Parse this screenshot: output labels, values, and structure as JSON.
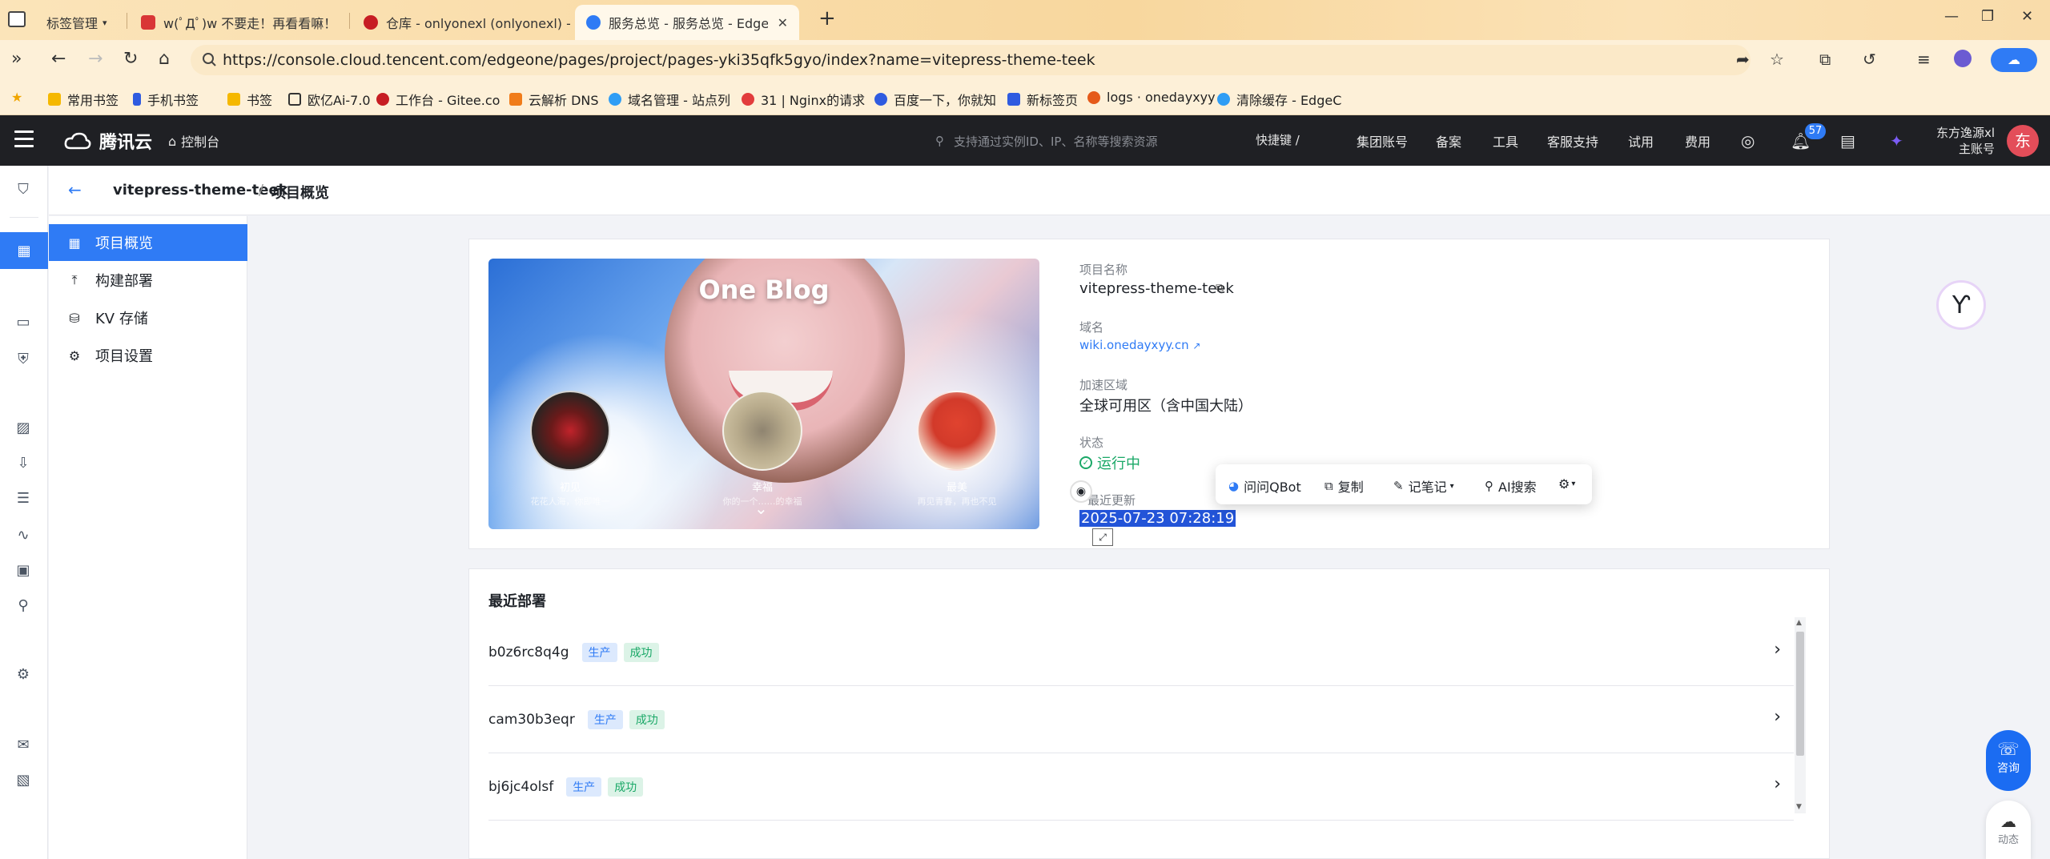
{
  "browser": {
    "tabs": [
      {
        "label": "标签管理",
        "active": false
      },
      {
        "label": "w(ﾟДﾟ)w 不要走！再看看嘛！",
        "active": false
      },
      {
        "label": "仓库 - onlyonexl (onlyonexl) - ",
        "active": false
      },
      {
        "label": "服务总览 - 服务总览 - EdgeO",
        "active": true
      }
    ],
    "url": "https://console.cloud.tencent.com/edgeone/pages/project/pages-yki35qfk5gyo/index?name=vitepress-theme-teek",
    "bookmarks": [
      "常用书签",
      "手机书签",
      "书签",
      "欧亿Ai-7.0",
      "工作台 - Gitee.co",
      "云解析 DNS",
      "域名管理 - 站点列",
      "31 | Nginx的请求",
      "百度一下，你就知",
      "新标签页",
      "logs · onedayxyy",
      "清除缓存 - EdgeC"
    ]
  },
  "header": {
    "brand": "腾讯云",
    "console": "控制台",
    "search_placeholder": "支持通过实例ID、IP、名称等搜索资源",
    "shortcut": "快捷键 /",
    "nav": [
      "集团账号",
      "备案",
      "工具",
      "客服支持",
      "试用",
      "费用"
    ],
    "notification_count": "57",
    "account_name": "东方逸源xl",
    "account_role": "主账号",
    "avatar_initial": "东"
  },
  "breadcrumb": {
    "project": "vitepress-theme-teek",
    "separator": "/",
    "current": "项目概览"
  },
  "subnav": [
    {
      "label": "项目概览",
      "active": true,
      "icon": "grid-icon"
    },
    {
      "label": "构建部署",
      "active": false,
      "icon": "upload-icon"
    },
    {
      "label": "KV 存储",
      "active": false,
      "icon": "database-icon"
    },
    {
      "label": "项目设置",
      "active": false,
      "icon": "gear-icon"
    }
  ],
  "overview": {
    "banner_title": "One Blog ",
    "thumbs": [
      {
        "label": "初见",
        "sub": "花花人海，你即唯一"
      },
      {
        "label": "幸福",
        "sub": "你的一个……的幸福"
      },
      {
        "label": "最美",
        "sub": "再见青春，再也不见"
      }
    ],
    "project_name_label": "项目名称",
    "project_name": "vitepress-theme-teek",
    "domain_label": "域名",
    "domain": "wiki.onedayxyy.cn",
    "region_label": "加速区域",
    "region": "全球可用区（含中国大陆）",
    "status_label": "状态",
    "status": "运行中",
    "updated_label": "最近更新",
    "updated": "2025-07-23 07:28:19"
  },
  "selection_toolbar": {
    "ask": "问问QBot",
    "copy": "复制",
    "note": "记笔记",
    "ai_search": "AI搜索"
  },
  "deploys": {
    "title": "最近部署",
    "rows": [
      {
        "id": "b0z6rc8q4g",
        "env": "生产",
        "status": "成功"
      },
      {
        "id": "cam30b3eqr",
        "env": "生产",
        "status": "成功"
      },
      {
        "id": "bj6jc4olsf",
        "env": "生产",
        "status": "成功"
      }
    ]
  },
  "floaters": {
    "consult": "咨询",
    "dynamic": "动态"
  },
  "colors": {
    "accent": "#2f7bf5",
    "success": "#1aa867",
    "header_bg": "#1f2024"
  }
}
